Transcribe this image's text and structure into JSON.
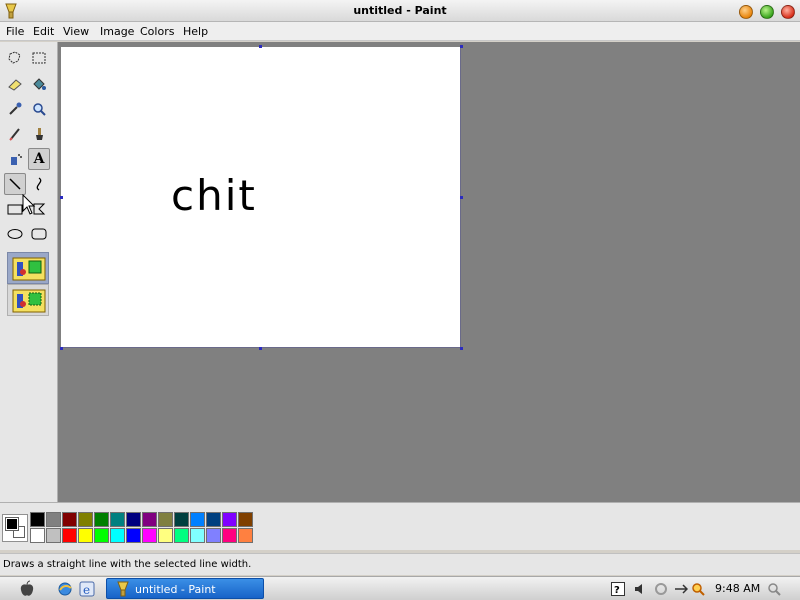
{
  "window": {
    "title": "untitled - Paint"
  },
  "menu": {
    "items": [
      "File",
      "Edit",
      "View",
      "Image",
      "Colors",
      "Help"
    ]
  },
  "tools": [
    {
      "name": "free-form-select-icon"
    },
    {
      "name": "select-icon"
    },
    {
      "name": "eraser-icon"
    },
    {
      "name": "fill-icon"
    },
    {
      "name": "pick-color-icon"
    },
    {
      "name": "magnifier-icon"
    },
    {
      "name": "pencil-icon"
    },
    {
      "name": "brush-icon"
    },
    {
      "name": "airbrush-icon"
    },
    {
      "name": "text-icon",
      "glyph": "A"
    },
    {
      "name": "line-icon"
    },
    {
      "name": "curve-icon"
    },
    {
      "name": "rectangle-icon"
    },
    {
      "name": "polygon-icon"
    },
    {
      "name": "ellipse-icon"
    },
    {
      "name": "rounded-rectangle-icon"
    }
  ],
  "canvas": {
    "text": "chit"
  },
  "palette": {
    "foreground": "#000000",
    "background": "#ffffff",
    "colors_top": [
      "#000000",
      "#808080",
      "#800000",
      "#808000",
      "#008000",
      "#008080",
      "#000080",
      "#800080",
      "#808040",
      "#004040",
      "#0080ff",
      "#004080",
      "#8000ff",
      "#804000"
    ],
    "colors_bottom": [
      "#ffffff",
      "#c0c0c0",
      "#ff0000",
      "#ffff00",
      "#00ff00",
      "#00ffff",
      "#0000ff",
      "#ff00ff",
      "#ffff80",
      "#00ff80",
      "#80ffff",
      "#8080ff",
      "#ff0080",
      "#ff8040"
    ]
  },
  "status": {
    "text": "Draws a straight line with the selected line width."
  },
  "taskbar": {
    "task_label": "untitled - Paint",
    "clock": "9:48 AM"
  }
}
